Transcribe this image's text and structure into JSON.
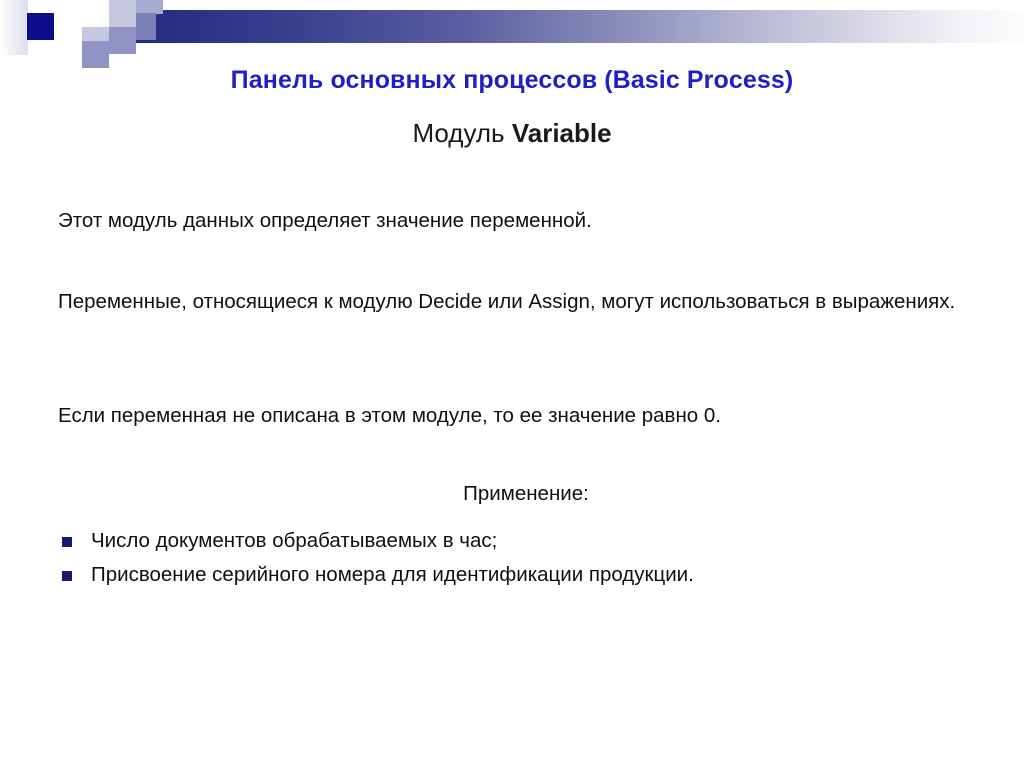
{
  "slide": {
    "title": "Панель основных процессов (Basic Process)",
    "subtitle_normal": "Модуль ",
    "subtitle_bold": "Variable",
    "paragraphs": {
      "p1": "Этот модуль данных определяет значение переменной.",
      "p2": "Переменные, относящиеся к модулю Decide или Assign, могут использоваться в выражениях.",
      "p3": "Если переменная не описана в этом модуле, то ее значение равно 0."
    },
    "usage_heading": "Применение:",
    "usage_items": [
      "Число документов обрабатываемых в час;",
      "Присвоение серийного номера для идентификации продукции."
    ],
    "colors": {
      "title": "#1f1fc4",
      "bullet": "#191970",
      "band_dark": "#232a7c",
      "band_light": "#fdfdfe",
      "accent_square": "#0d0d8c"
    }
  }
}
